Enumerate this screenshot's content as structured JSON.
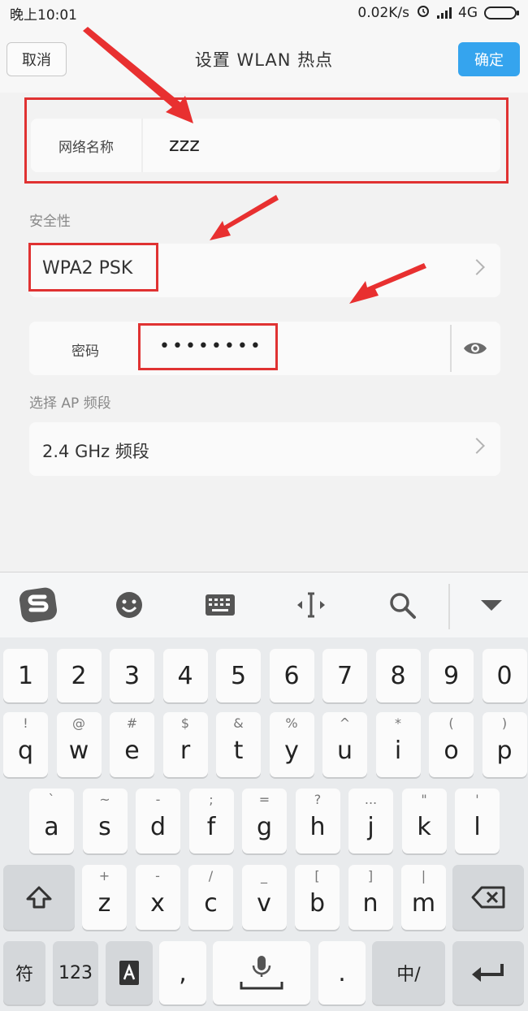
{
  "status_bar": {
    "time": "晚上10:01",
    "net_speed": "0.02K/s",
    "network": "4G"
  },
  "header": {
    "cancel_label": "取消",
    "title": "设置  WLAN  热点",
    "confirm_label": "确定"
  },
  "form": {
    "ssid_label": "网络名称",
    "ssid_value": "zzz",
    "security_label": "安全性",
    "security_value": "WPA2 PSK",
    "password_label": "密码",
    "password_value": "••••••••",
    "band_label": "选择 AP 频段",
    "band_value": "2.4 GHz 频段"
  },
  "keyboard": {
    "row_numbers": [
      "1",
      "2",
      "3",
      "4",
      "5",
      "6",
      "7",
      "8",
      "9",
      "0"
    ],
    "row_q": [
      {
        "ch": "q",
        "sym": "!"
      },
      {
        "ch": "w",
        "sym": "@"
      },
      {
        "ch": "e",
        "sym": "#"
      },
      {
        "ch": "r",
        "sym": "$"
      },
      {
        "ch": "t",
        "sym": "&"
      },
      {
        "ch": "y",
        "sym": "%"
      },
      {
        "ch": "u",
        "sym": "^"
      },
      {
        "ch": "i",
        "sym": "*"
      },
      {
        "ch": "o",
        "sym": "("
      },
      {
        "ch": "p",
        "sym": ")"
      }
    ],
    "row_a": [
      {
        "ch": "a",
        "sym": "`"
      },
      {
        "ch": "s",
        "sym": "~"
      },
      {
        "ch": "d",
        "sym": "-"
      },
      {
        "ch": "f",
        "sym": ";"
      },
      {
        "ch": "g",
        "sym": "="
      },
      {
        "ch": "h",
        "sym": "?"
      },
      {
        "ch": "j",
        "sym": "..."
      },
      {
        "ch": "k",
        "sym": "\""
      },
      {
        "ch": "l",
        "sym": "'"
      }
    ],
    "row_z": [
      {
        "ch": "z",
        "sym": "+"
      },
      {
        "ch": "x",
        "sym": "-"
      },
      {
        "ch": "c",
        "sym": "/"
      },
      {
        "ch": "v",
        "sym": "_"
      },
      {
        "ch": "b",
        "sym": "["
      },
      {
        "ch": "n",
        "sym": "]"
      },
      {
        "ch": "m",
        "sym": "|"
      }
    ],
    "symbols_label": "符",
    "numbers_label": "123",
    "comma_label": ",",
    "period_label": ".",
    "lang_label": "中/"
  },
  "colors": {
    "confirm_button": "#35a4ee",
    "highlight": "#e03232"
  },
  "icons": [
    "signal-icon",
    "alarm-icon",
    "battery-icon",
    "sogou-logo-icon",
    "emoji-icon",
    "keyboard-icon",
    "cursor-icon",
    "search-icon",
    "collapse-icon",
    "eye-icon",
    "chevron-right-icon",
    "shift-icon",
    "backspace-icon",
    "mic-icon",
    "translate-icon",
    "enter-icon"
  ]
}
